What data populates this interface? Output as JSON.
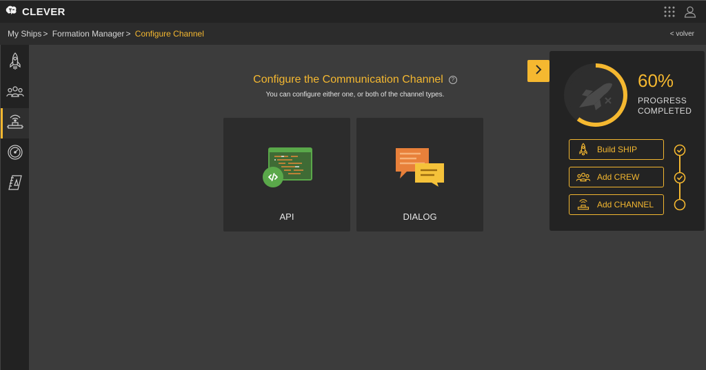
{
  "app": {
    "name": "CLEVER"
  },
  "breadcrumb": {
    "items": [
      "My Ships",
      "Formation Manager",
      "Configure Channel"
    ],
    "separator": ">",
    "back_label": "< volver"
  },
  "sidebar": {
    "items": [
      {
        "name": "ship",
        "icon": "rocket-icon"
      },
      {
        "name": "crew",
        "icon": "crew-icon"
      },
      {
        "name": "channel",
        "icon": "channel-icon",
        "active": true
      },
      {
        "name": "dashboard",
        "icon": "gauge-icon"
      },
      {
        "name": "logbook",
        "icon": "notebook-icon"
      }
    ]
  },
  "main": {
    "title": "Configure the Communication Channel",
    "help_glyph": "?",
    "subtitle": "You can configure either one, or both of the channel types.",
    "cards": [
      {
        "label": "API",
        "icon": "api-code-icon"
      },
      {
        "label": "DIALOG",
        "icon": "dialog-bubbles-icon"
      }
    ]
  },
  "progress_panel": {
    "percent": 0.6,
    "percent_text": "60%",
    "label_line1": "PROGRESS",
    "label_line2": "COMPLETED",
    "steps": [
      {
        "label": "Build SHIP",
        "icon": "rocket-icon",
        "done": true
      },
      {
        "label": "Add CREW",
        "icon": "crew-icon",
        "done": true
      },
      {
        "label": "Add CHANNEL",
        "icon": "channel-icon",
        "done": false
      }
    ]
  },
  "colors": {
    "accent": "#f5b830",
    "top_bar": "#232323",
    "background": "#3c3c3c",
    "card": "#2c2c2c",
    "api_green": "#5aa84a",
    "dialog_orange": "#e8803a"
  }
}
